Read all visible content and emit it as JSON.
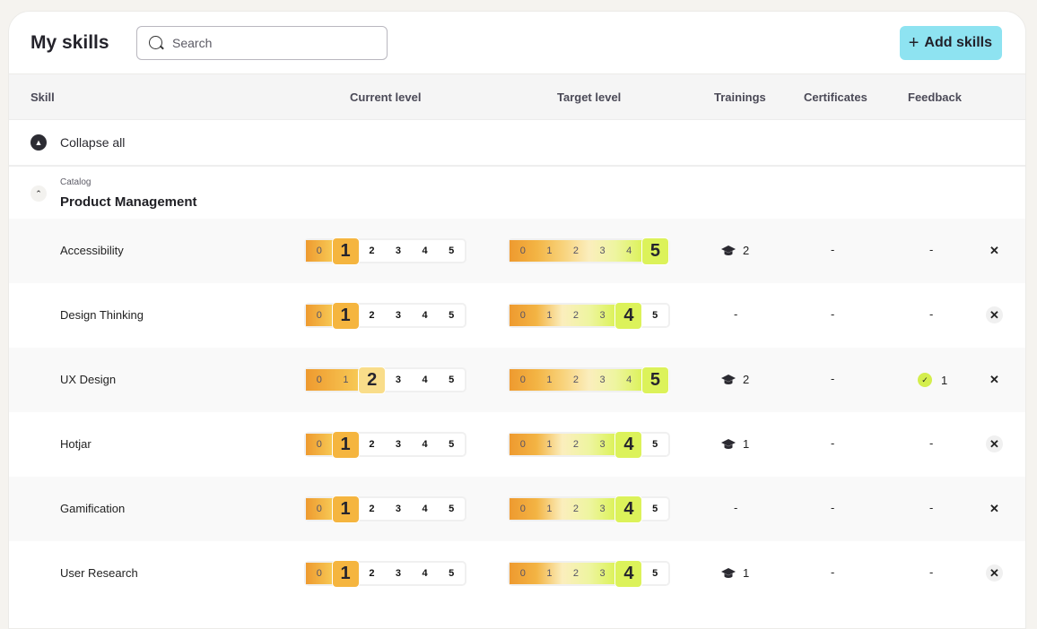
{
  "header": {
    "title": "My skills",
    "search_placeholder": "Search",
    "add_button_label": "Add skills"
  },
  "table": {
    "columns": [
      "Skill",
      "Current level",
      "Target level",
      "Trainings",
      "Certificates",
      "Feedback"
    ],
    "collapse_all_label": "Collapse all",
    "group": {
      "category_label": "Catalog",
      "name": "Product Management"
    },
    "level_scale": [
      "0",
      "1",
      "2",
      "3",
      "4",
      "5"
    ],
    "rows": [
      {
        "skill": "Accessibility",
        "current_level": 1,
        "target_level": 5,
        "trainings": "2",
        "certificates": "-",
        "feedback": "-"
      },
      {
        "skill": "Design Thinking",
        "current_level": 1,
        "target_level": 4,
        "trainings": "-",
        "certificates": "-",
        "feedback": "-"
      },
      {
        "skill": "UX Design",
        "current_level": 2,
        "target_level": 5,
        "trainings": "2",
        "certificates": "-",
        "feedback": "1"
      },
      {
        "skill": "Hotjar",
        "current_level": 1,
        "target_level": 4,
        "trainings": "1",
        "certificates": "-",
        "feedback": "-"
      },
      {
        "skill": "Gamification",
        "current_level": 1,
        "target_level": 4,
        "trainings": "-",
        "certificates": "-",
        "feedback": "-"
      },
      {
        "skill": "User Research",
        "current_level": 1,
        "target_level": 4,
        "trainings": "1",
        "certificates": "-",
        "feedback": "-"
      }
    ]
  },
  "icons": {
    "search": "search-icon",
    "add": "plus-icon",
    "collapse": "chevron-up-icon",
    "training": "graduation-cap-icon",
    "feedback": "check-circle-icon",
    "remove": "close-icon"
  },
  "colors": {
    "accent_button": "#8ee3f1",
    "current_level_fill": "#f0a838",
    "current_selected": "#f5b53f",
    "target_selected": "#dcf25a",
    "feedback_badge": "#d4ee4d"
  }
}
